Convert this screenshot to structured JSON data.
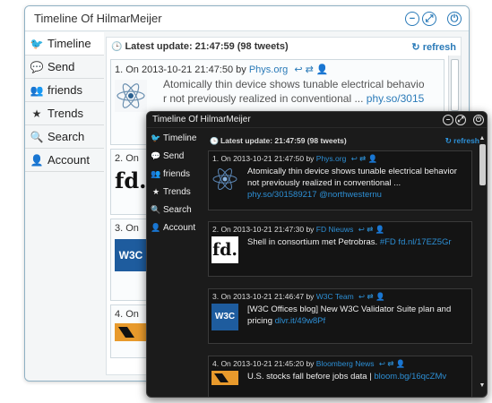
{
  "light_window": {
    "title": "Timeline Of HilmarMeijer",
    "buttons": {
      "collapse": "−",
      "expand": "⤢",
      "power": "⏻"
    },
    "sidebar": [
      {
        "label": "Timeline",
        "icon": "twitter-bird-icon",
        "glyph": "🐦"
      },
      {
        "label": "Send",
        "icon": "speech-bubble-icon",
        "glyph": "💬"
      },
      {
        "label": "friends",
        "icon": "users-icon",
        "glyph": "👥"
      },
      {
        "label": "Trends",
        "icon": "star-icon",
        "glyph": "★"
      },
      {
        "label": "Search",
        "icon": "search-icon",
        "glyph": "🔍"
      },
      {
        "label": "Account",
        "icon": "person-icon",
        "glyph": "👤"
      }
    ],
    "header": {
      "clock": "🕒",
      "text": "Latest update: 21:47:59 (98 tweets)",
      "refresh": "↻ refresh"
    },
    "tweets": [
      {
        "meta_prefix": "1. On 2013-10-21 21:47:50 by ",
        "source": "Phys.org",
        "body_line1": "Atomically thin device shows tunable electrical behavio",
        "body_line2": "r not previously realized in conventional ... ",
        "link": "phy.so/3015"
      },
      {
        "meta_prefix": "2. On",
        "source": "",
        "body_line1": "",
        "body_line2": "",
        "link": ""
      },
      {
        "meta_prefix": "3. On",
        "source": "",
        "body_line1": "",
        "body_line2": "",
        "link": ""
      },
      {
        "meta_prefix": "4. On",
        "source": "",
        "body_line1": "",
        "body_line2": "",
        "link": ""
      }
    ],
    "actions": "↩ ⇄ 👤"
  },
  "dark_window": {
    "title": "Timeline Of HilmarMeijer",
    "buttons": {
      "collapse": "−",
      "expand": "⤢",
      "power": "⏻"
    },
    "sidebar": [
      {
        "label": "Timeline",
        "icon": "twitter-bird-icon",
        "glyph": "🐦"
      },
      {
        "label": "Send",
        "icon": "speech-bubble-icon",
        "glyph": "💬"
      },
      {
        "label": "friends",
        "icon": "users-icon",
        "glyph": "👥"
      },
      {
        "label": "Trends",
        "icon": "star-icon",
        "glyph": "★"
      },
      {
        "label": "Search",
        "icon": "search-icon",
        "glyph": "🔍"
      },
      {
        "label": "Account",
        "icon": "person-icon",
        "glyph": "👤"
      }
    ],
    "header": {
      "clock": "🕒",
      "text": "Latest update: 21:47:59 (98 tweets)",
      "refresh": "↻ refresh"
    },
    "tweets": [
      {
        "meta_prefix": "1. On 2013-10-21 21:47:50 by ",
        "source": "Phys.org",
        "text": "Atomically thin device shows tunable electrical behavior not previously realized in conventional ... ",
        "link": "phy.so/301589217 @northwesternu"
      },
      {
        "meta_prefix": "2. On 2013-10-21 21:47:30 by ",
        "source": "FD Nieuws",
        "text": "Shell in consortium met Petrobras. ",
        "link": "#FD fd.nl/17EZ5Gr"
      },
      {
        "meta_prefix": "3. On 2013-10-21 21:46:47 by ",
        "source": "W3C Team",
        "text": "[W3C Offices blog] New W3C Validator Suite plan and pricing ",
        "link": "dlvr.it/49w8Pf"
      },
      {
        "meta_prefix": "4. On 2013-10-21 21:45:20 by ",
        "source": "Bloomberg News",
        "text": "U.S. stocks fall before jobs data | ",
        "link": "bloom.bg/16qcZMv"
      }
    ],
    "actions": "↩ ⇄ 👤",
    "scroll": {
      "up": "▲",
      "down": "▼"
    }
  },
  "thumbs": {
    "fd": "fd.",
    "w3c": "W3C"
  },
  "colors": {
    "accent": "#2a7ab8",
    "dark_accent": "#2d8fd5",
    "light_border": "#8fb1c4",
    "dark_bg": "#1b1b1b"
  }
}
